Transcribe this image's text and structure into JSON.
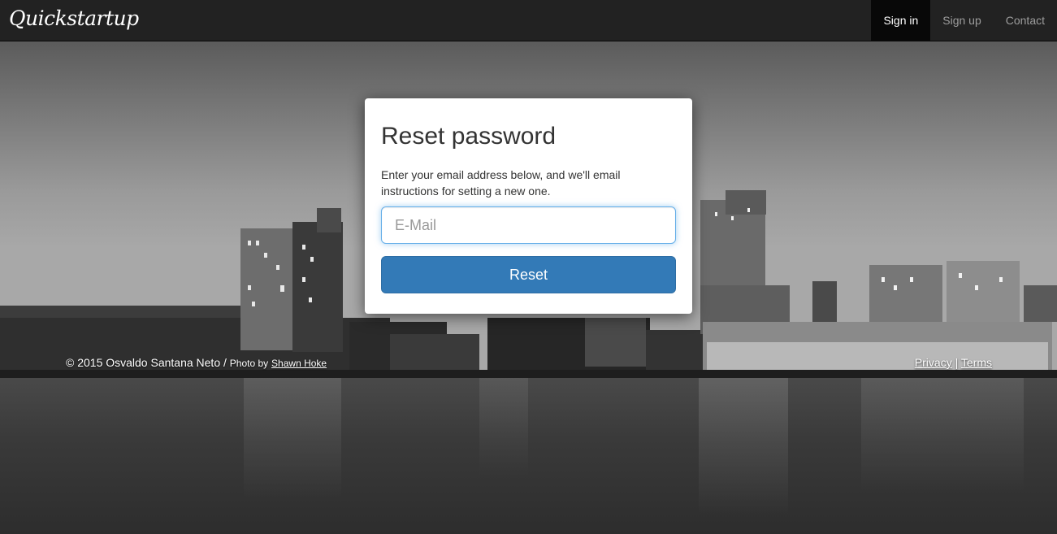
{
  "navbar": {
    "brand": "Quickstartup",
    "links": [
      {
        "label": "Sign in",
        "active": true
      },
      {
        "label": "Sign up",
        "active": false
      },
      {
        "label": "Contact",
        "active": false
      }
    ]
  },
  "card": {
    "title": "Reset password",
    "description": "Enter your email address below, and we'll email instructions for setting a new one.",
    "email_placeholder": "E-Mail",
    "email_value": "",
    "submit_label": "Reset"
  },
  "footer": {
    "copyright": "© 2015 Osvaldo Santana Neto /",
    "photo_by": "Photo by",
    "photographer": "Shawn Hoke",
    "privacy": "Privacy",
    "separator": "|",
    "terms": "Terms"
  },
  "colors": {
    "navbar_bg": "#222222",
    "active_nav_bg": "#080808",
    "primary": "#337ab7",
    "focus_border": "#66afe9"
  }
}
